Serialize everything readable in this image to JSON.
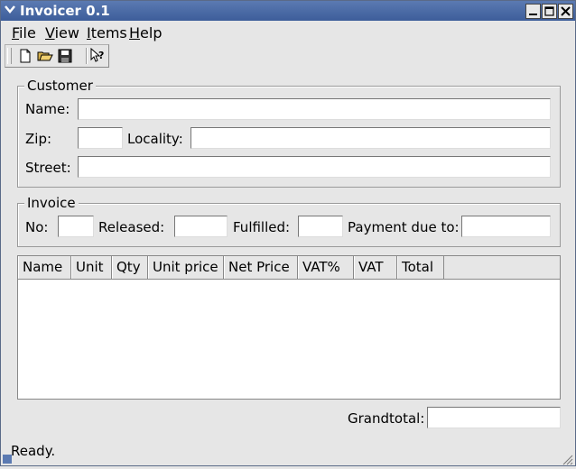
{
  "window": {
    "title": "Invoicer 0.1",
    "controls": [
      "minimize",
      "maximize",
      "close"
    ]
  },
  "menubar": {
    "items": [
      {
        "label": "File",
        "mnemonic": "F"
      },
      {
        "label": "View",
        "mnemonic": "V"
      },
      {
        "label": "Items",
        "mnemonic": "I"
      },
      {
        "label": "Help",
        "mnemonic": "H"
      }
    ]
  },
  "toolbar": {
    "buttons": [
      "new-file-icon",
      "open-folder-icon",
      "save-icon",
      "whats-this-icon"
    ]
  },
  "customer": {
    "title": "Customer",
    "name_label": "Name:",
    "name_value": "",
    "zip_label": "Zip:",
    "zip_value": "",
    "locality_label": "Locality:",
    "locality_value": "",
    "street_label": "Street:",
    "street_value": ""
  },
  "invoice": {
    "title": "Invoice",
    "no_label": "No:",
    "no_value": "",
    "released_label": "Released:",
    "released_value": "",
    "fulfilled_label": "Fulfilled:",
    "fulfilled_value": "",
    "payment_due_label": "Payment due to:",
    "payment_due_value": ""
  },
  "items_table": {
    "columns": [
      "Name",
      "Unit",
      "Qty",
      "Unit price",
      "Net Price",
      "VAT%",
      "VAT",
      "Total"
    ],
    "rows": []
  },
  "grandtotal": {
    "label": "Grandtotal:",
    "value": ""
  },
  "status": {
    "text": "Ready."
  }
}
